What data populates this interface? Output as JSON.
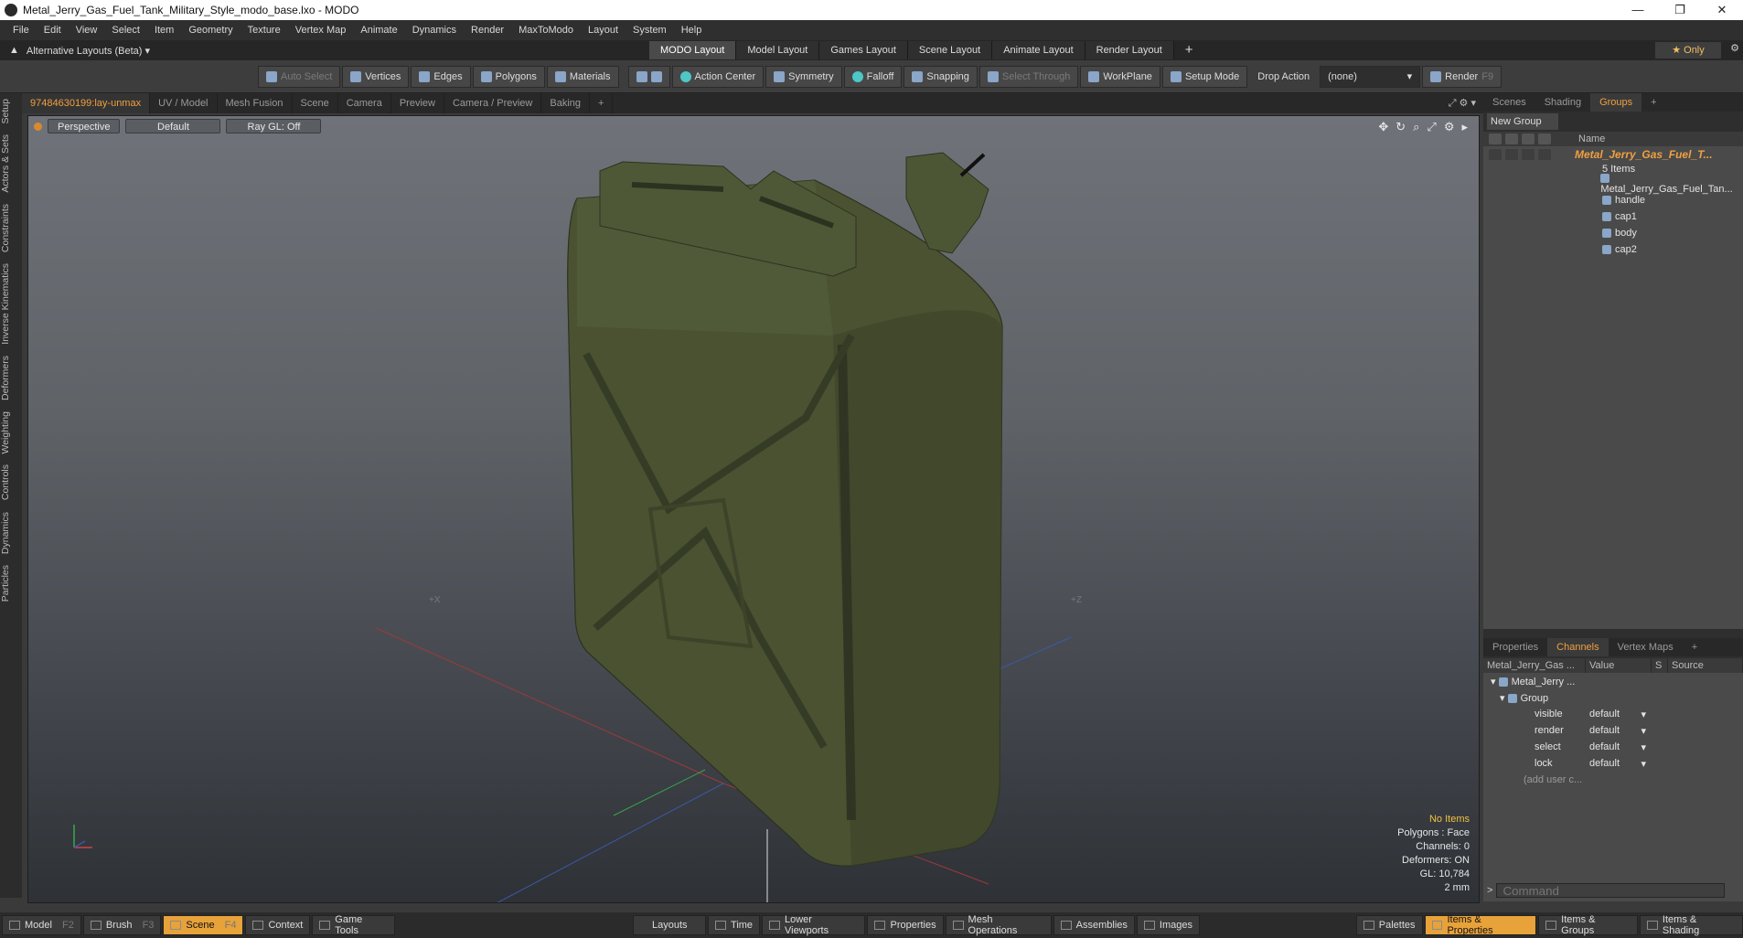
{
  "window": {
    "title": "Metal_Jerry_Gas_Fuel_Tank_Military_Style_modo_base.lxo - MODO",
    "controls": [
      "—",
      "❐",
      "✕"
    ]
  },
  "menu": [
    "File",
    "Edit",
    "View",
    "Select",
    "Item",
    "Geometry",
    "Texture",
    "Vertex Map",
    "Animate",
    "Dynamics",
    "Render",
    "MaxToModo",
    "Layout",
    "System",
    "Help"
  ],
  "layout_bar": {
    "alt_label": "Alternative Layouts (Beta) ▾",
    "tabs": [
      "MODO Layout",
      "Model Layout",
      "Games Layout",
      "Scene Layout",
      "Animate Layout",
      "Render Layout"
    ],
    "plus": "+",
    "only": "★ Only"
  },
  "toolbar": {
    "auto_select": "Auto Select",
    "vertices": "Vertices",
    "edges": "Edges",
    "polygons": "Polygons",
    "materials": "Materials",
    "action_center": "Action Center",
    "symmetry": "Symmetry",
    "falloff": "Falloff",
    "snapping": "Snapping",
    "select_through": "Select Through",
    "workplane": "WorkPlane",
    "setup_mode": "Setup Mode",
    "drop_action": "Drop Action",
    "drop_value": "(none)",
    "render": "Render",
    "render_key": "F9"
  },
  "left_tabs": [
    "Setup",
    "Actors & Sets",
    "Constraints",
    "Inverse Kinematics",
    "Deformers",
    "Weighting",
    "Controls",
    "Dynamics",
    "Particles"
  ],
  "viewport_tabs": [
    "97484630199:lay-unmax",
    "UV / Model",
    "Mesh Fusion",
    "Scene",
    "Camera",
    "Preview",
    "Camera / Preview",
    "Baking",
    "+"
  ],
  "viewport": {
    "view": "Perspective",
    "shading": "Default",
    "raygl": "Ray GL: Off",
    "axis_x_label": "+X",
    "axis_z_label": "+Z",
    "info": {
      "selection": "No Items",
      "polygons": "Polygons : Face",
      "channels": "Channels: 0",
      "deformers": "Deformers: ON",
      "gl": "GL: 10,784",
      "grid": "2 mm"
    }
  },
  "groups_panel": {
    "tabs": [
      "Scenes",
      "Shading",
      "Groups",
      "+"
    ],
    "new_group": "New Group",
    "name_header": "Name",
    "group_name": "Metal_Jerry_Gas_Fuel_T...",
    "item_count": "5 Items",
    "items": [
      "Metal_Jerry_Gas_Fuel_Tan...",
      "handle",
      "cap1",
      "body",
      "cap2"
    ]
  },
  "channels_panel": {
    "tabs": [
      "Properties",
      "Channels",
      "Vertex Maps",
      "+"
    ],
    "headers": [
      "Metal_Jerry_Gas ...",
      "Value",
      "S",
      "Source"
    ],
    "item": "Metal_Jerry ...",
    "group": "Group",
    "rows": [
      {
        "name": "visible",
        "value": "default"
      },
      {
        "name": "render",
        "value": "default"
      },
      {
        "name": "select",
        "value": "default"
      },
      {
        "name": "lock",
        "value": "default"
      }
    ],
    "add_user": "(add user c...",
    "command_placeholder": "Command"
  },
  "bottom_bar": {
    "model": "Model",
    "model_key": "F2",
    "brush": "Brush",
    "brush_key": "F3",
    "scene": "Scene",
    "scene_key": "F4",
    "context": "Context",
    "game_tools": "Game Tools",
    "layouts": "Layouts",
    "time": "Time",
    "lower_viewports": "Lower Viewports",
    "properties": "Properties",
    "mesh_operations": "Mesh Operations",
    "assemblies": "Assemblies",
    "images": "Images",
    "palettes": "Palettes",
    "items_properties": "Items & Properties",
    "items_groups": "Items & Groups",
    "items_shading": "Items & Shading"
  },
  "colors": {
    "accent": "#f0a040",
    "tank": "#4a5232",
    "viewport_top": "#6f7379",
    "viewport_bottom": "#2e3136"
  }
}
